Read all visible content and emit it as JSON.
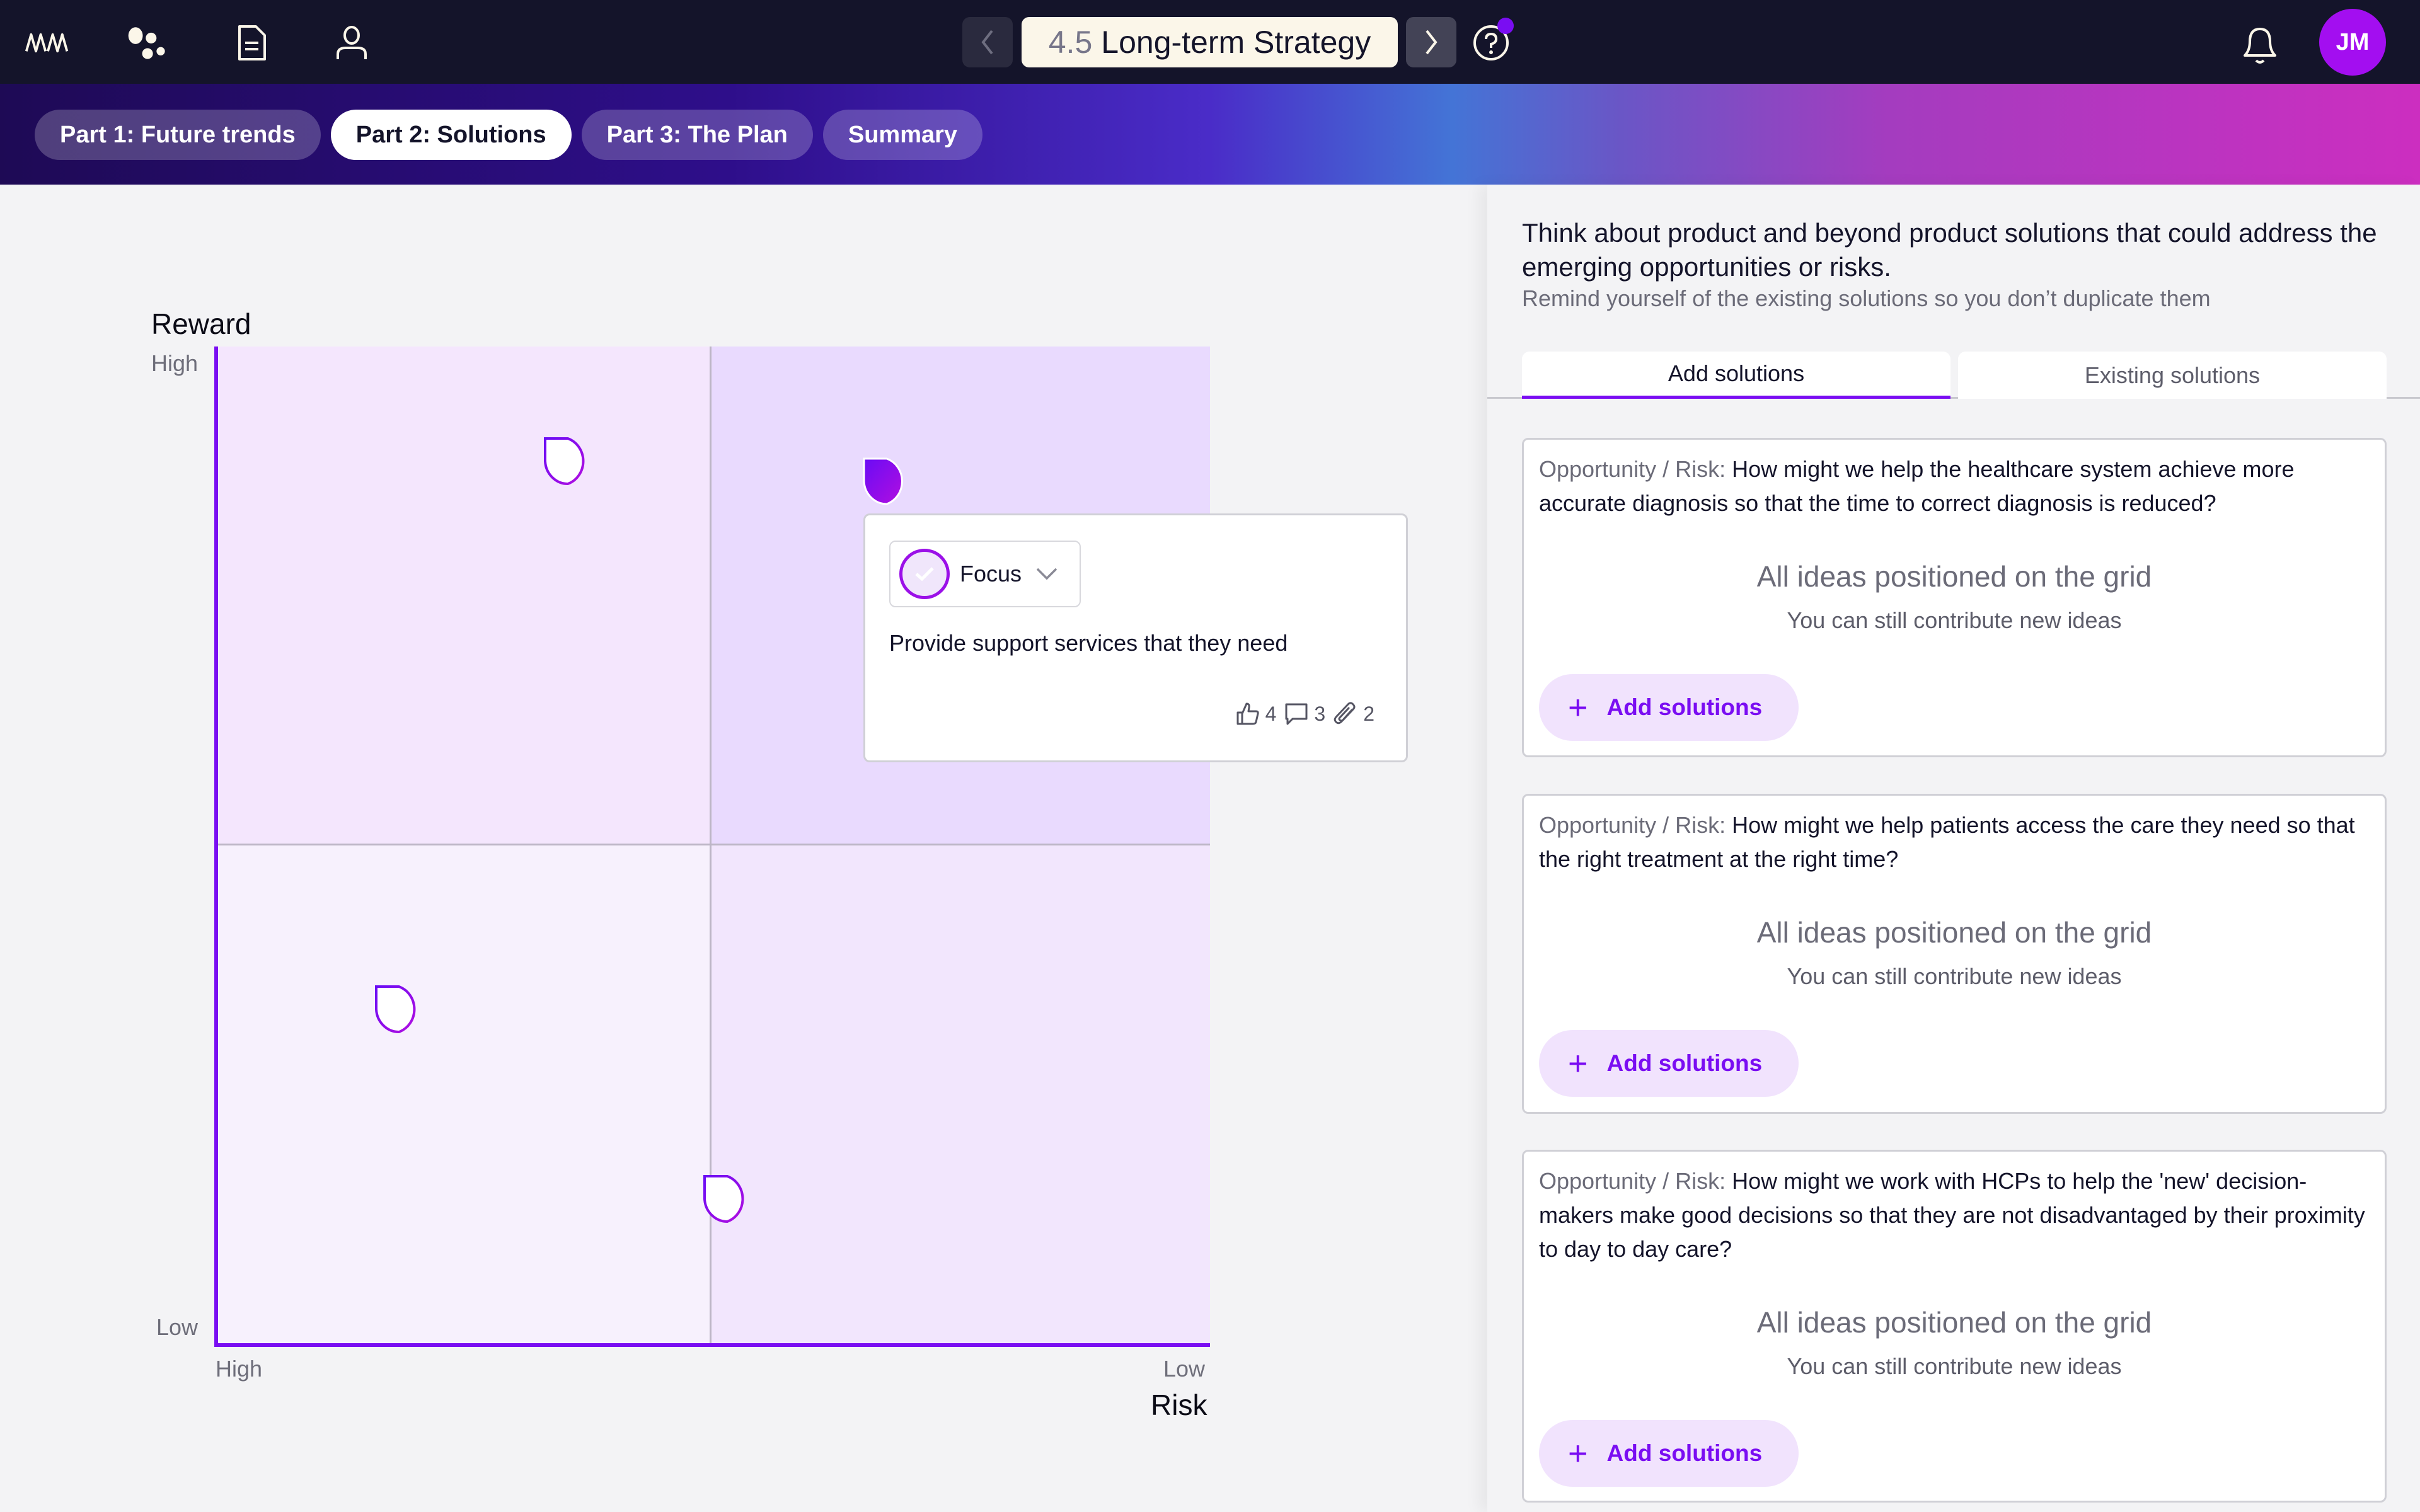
{
  "topbar": {
    "logo_text": "NM",
    "icons": [
      "logo-icon",
      "dots-icon",
      "document-icon",
      "user-icon"
    ],
    "title_number": "4.5",
    "title_text": "Long-term Strategy",
    "prev_label": "Previous",
    "next_label": "Next",
    "help_has_notification": true,
    "avatar_initials": "JM"
  },
  "colors": {
    "accent": "#7a0df2",
    "avatar": "#a30ef0",
    "topbar_bg": "#14142a",
    "title_bg": "#fbf6e9"
  },
  "phase_tabs": [
    {
      "label": "Part 1: Future trends",
      "active": false
    },
    {
      "label": "Part 2: Solutions",
      "active": true
    },
    {
      "label": "Part 3: The Plan",
      "active": false
    },
    {
      "label": "Summary",
      "active": false
    }
  ],
  "grid": {
    "y_title": "Reward",
    "y_high": "High",
    "y_low": "Low",
    "x_title": "Risk",
    "x_high": "High",
    "x_low": "Low",
    "markers": [
      {
        "id": "idea-1",
        "x": 0.33,
        "y": 0.91,
        "selected": false
      },
      {
        "id": "idea-2",
        "x": 0.65,
        "y": 0.89,
        "selected": true
      },
      {
        "id": "idea-3",
        "x": 0.16,
        "y": 0.36,
        "selected": false
      },
      {
        "id": "idea-4",
        "x": 0.49,
        "y": 0.17,
        "selected": false
      }
    ]
  },
  "idea_card": {
    "status": "Focus",
    "text": "Provide support services that they need",
    "likes": "4",
    "comments": "3",
    "attachments": "2"
  },
  "panel": {
    "heading": "Think about product and beyond product solutions that could address the emerging opportunities or risks.",
    "subheading": "Remind yourself of the existing solutions so you don’t duplicate them",
    "tabs": [
      {
        "label": "Add solutions",
        "active": true
      },
      {
        "label": "Existing solutions",
        "active": false
      }
    ],
    "cards": [
      {
        "label": "Opportunity / Risk:",
        "question": "How might we help the healthcare system achieve more accurate diagnosis so that the time to correct diagnosis is reduced?",
        "status": "All ideas positioned on the grid",
        "note": "You can still contribute new ideas",
        "button": "Add solutions"
      },
      {
        "label": "Opportunity / Risk:",
        "question": "How might we help patients access the care they need so that the right treatment at the right time?",
        "status": "All ideas positioned on the grid",
        "note": "You can still contribute new ideas",
        "button": "Add solutions"
      },
      {
        "label": "Opportunity / Risk:",
        "question": "How might we work with HCPs to help the 'new' decision-makers make good decisions so that they are not disadvantaged by their proximity to day to day care?",
        "status": "All ideas positioned on the grid",
        "note": "You can still contribute new ideas",
        "button": "Add solutions"
      }
    ]
  }
}
